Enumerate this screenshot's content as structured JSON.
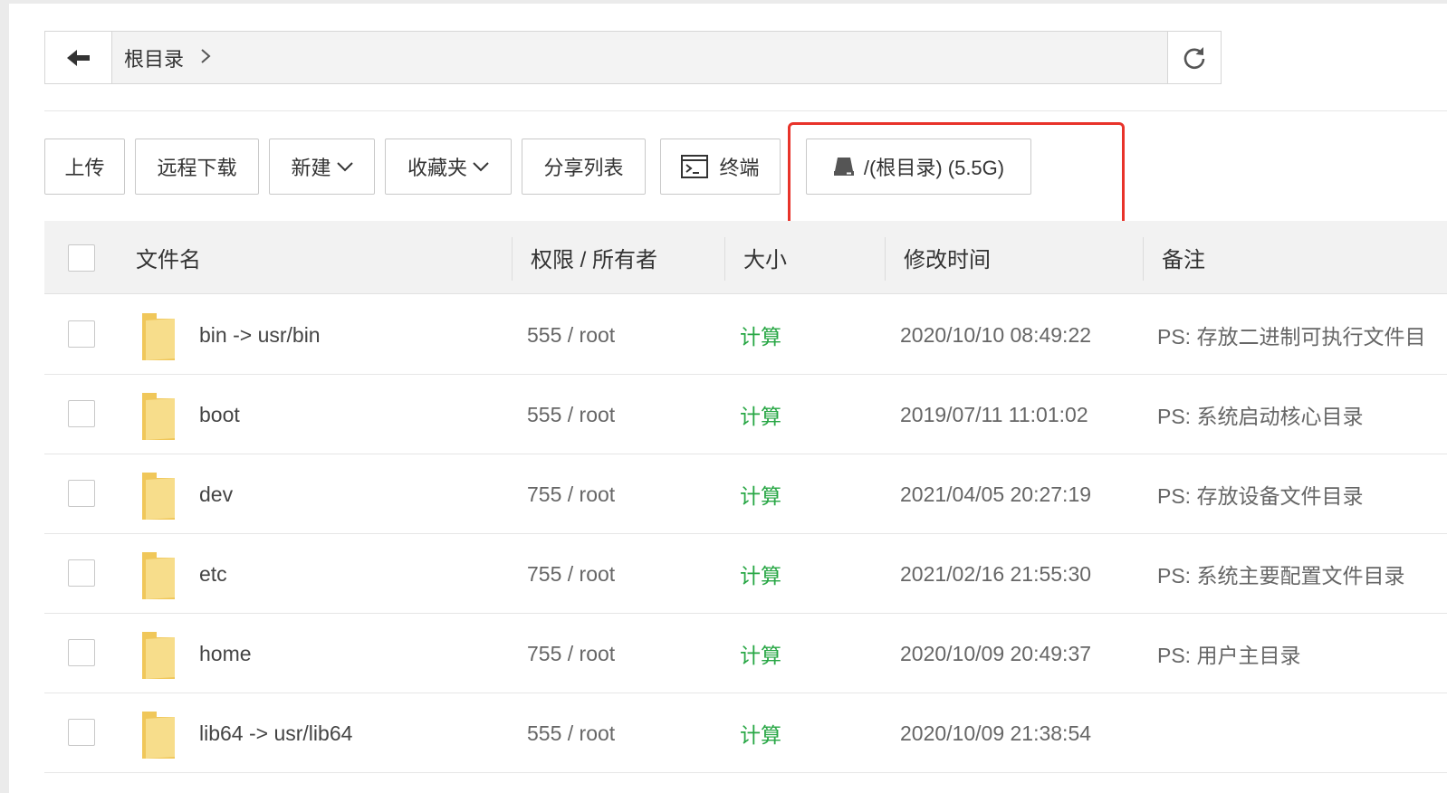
{
  "pathbar": {
    "back_icon": "arrow-left-icon",
    "crumbs": [
      {
        "label": "根目录"
      }
    ],
    "crumb_separator": ">",
    "refresh_icon": "refresh-icon"
  },
  "toolbar": {
    "upload": "上传",
    "remote_download": "远程下载",
    "new": "新建",
    "favorites": "收藏夹",
    "share_list": "分享列表",
    "terminal": "终端",
    "disk": "/(根目录) (5.5G)"
  },
  "table": {
    "headers": {
      "name": "文件名",
      "permission": "权限 / 所有者",
      "size": "大小",
      "mtime": "修改时间",
      "note": "备注"
    },
    "rows": [
      {
        "name": "bin -> usr/bin",
        "perm": "555 / root",
        "size": "计算",
        "mtime": "2020/10/10 08:49:22",
        "note": "PS: 存放二进制可执行文件目"
      },
      {
        "name": "boot",
        "perm": "555 / root",
        "size": "计算",
        "mtime": "2019/07/11 11:01:02",
        "note": "PS: 系统启动核心目录"
      },
      {
        "name": "dev",
        "perm": "755 / root",
        "size": "计算",
        "mtime": "2021/04/05 20:27:19",
        "note": "PS: 存放设备文件目录"
      },
      {
        "name": "etc",
        "perm": "755 / root",
        "size": "计算",
        "mtime": "2021/02/16 21:55:30",
        "note": "PS: 系统主要配置文件目录"
      },
      {
        "name": "home",
        "perm": "755 / root",
        "size": "计算",
        "mtime": "2020/10/09 20:49:37",
        "note": "PS: 用户主目录"
      },
      {
        "name": "lib64 -> usr/lib64",
        "perm": "555 / root",
        "size": "计算",
        "mtime": "2020/10/09 21:38:54",
        "note": ""
      }
    ]
  },
  "colors": {
    "accent_green": "#28a745",
    "highlight_red": "#e8332a",
    "folder_yellow": "#f5d774"
  }
}
